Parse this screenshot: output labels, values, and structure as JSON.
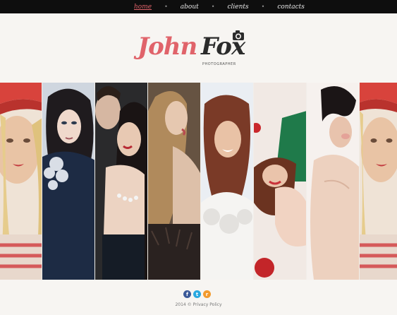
{
  "nav": {
    "items": [
      {
        "label": "home",
        "active": true
      },
      {
        "label": "about",
        "active": false
      },
      {
        "label": "clients",
        "active": false
      },
      {
        "label": "contacts",
        "active": false
      }
    ],
    "separator": "•"
  },
  "logo": {
    "first": "John",
    "last": "Fox",
    "tagline": "PHOTOGRAPHER",
    "icon": "camera-icon"
  },
  "gallery": {
    "panels": [
      {
        "name": "photo-woman-red-hat-left"
      },
      {
        "name": "photo-woman-feather-dress"
      },
      {
        "name": "photo-couple-embrace"
      },
      {
        "name": "photo-woman-long-hair-fur"
      },
      {
        "name": "photo-woman-smiling-white-fur"
      },
      {
        "name": "photo-woman-lying-red-apples"
      },
      {
        "name": "photo-woman-short-hair-bare"
      },
      {
        "name": "photo-woman-red-hat-right"
      }
    ]
  },
  "social": [
    {
      "icon": "facebook-icon",
      "glyph": "f",
      "color": "#3b5998"
    },
    {
      "icon": "twitter-icon",
      "glyph": "t",
      "color": "#2aa9e0"
    },
    {
      "icon": "rss-icon",
      "glyph": "r",
      "color": "#f29a2e"
    }
  ],
  "footer": {
    "year": "2014",
    "separator": "©",
    "link": "Privacy Policy"
  },
  "colors": {
    "accent": "#e0636a",
    "topbar": "#0e0e0e",
    "background": "#f7f5f2"
  }
}
